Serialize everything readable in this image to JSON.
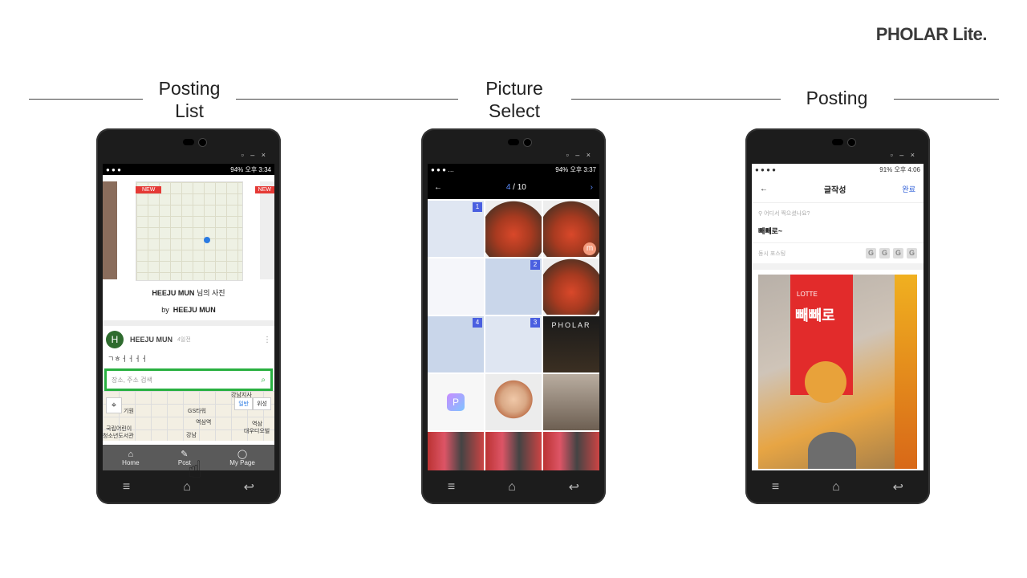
{
  "brand": "PHOLAR Lite.",
  "sections": [
    {
      "title_line1": "Posting",
      "title_line2": "List"
    },
    {
      "title_line1": "Picture",
      "title_line2": "Select"
    },
    {
      "title_line1": "Posting",
      "title_line2": ""
    }
  ],
  "phone1": {
    "status_time": "94% 오후 3:34",
    "badge_new": "NEW",
    "map_toggle": [
      "일반",
      "위성"
    ],
    "caption_user": "HEEJU MUN",
    "caption_suffix": "님의 사진",
    "by_label": "by",
    "by_user": "HEEJU MUN",
    "post_avatar": "H",
    "post_user": "HEEJU MUN",
    "post_time": "4일전",
    "post_text": "ㄱㅎㅓㅓㅓㅓ",
    "search_placeholder": "장소, 주소 검색",
    "map_labels": [
      "강남지사",
      "기원",
      "GS타워",
      "역삼역",
      "국립어린이",
      "청소년도서관",
      "강남",
      "역삼",
      "대우디오빌"
    ],
    "tabs": [
      "Home",
      "Post",
      "My Page"
    ]
  },
  "phone2": {
    "status_time": "94% 오후 3:37",
    "counter_current": "4",
    "counter_total": "/ 10",
    "badges": [
      "1",
      "2",
      "4",
      "3"
    ],
    "pholar_text": "PHOLAR",
    "m_badge": "m"
  },
  "phone3": {
    "status_time": "91% 오후 4:06",
    "title": "글작성",
    "done": "완료",
    "place_placeholder": "어디서 찍으셨나요?",
    "post_text": "빼빼로~",
    "share_label": "동시 포스팅",
    "share_icons": [
      "G",
      "G",
      "G",
      "G"
    ],
    "photo_brand": "LOTTE",
    "photo_product": "빼빼로"
  },
  "icons": {
    "back": "arrow-left-icon",
    "next": "chevron-right-icon",
    "search": "search-icon",
    "home": "home-icon",
    "post": "edit-icon",
    "mypage": "user-icon",
    "hand": "pointer-hand-icon"
  }
}
